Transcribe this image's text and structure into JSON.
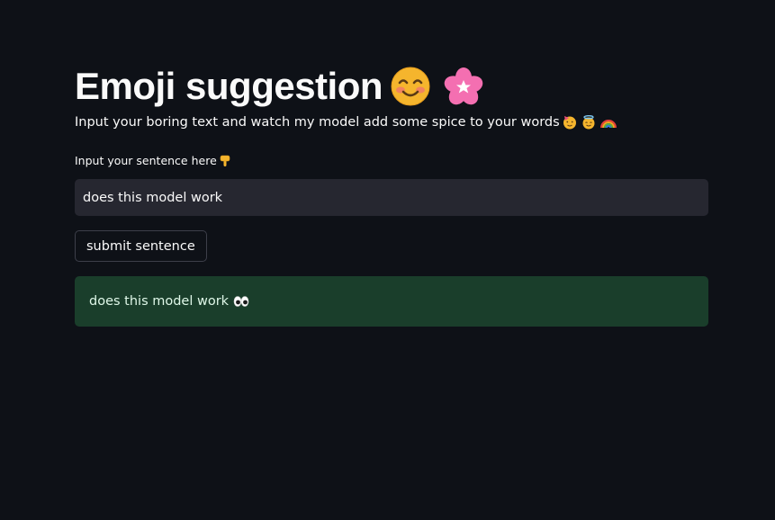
{
  "header": {
    "title": "Emoji suggestion",
    "title_emojis": [
      "smiling-face-icon",
      "cherry-blossom-icon"
    ]
  },
  "intro": {
    "description": "Input your boring text and watch my model add some spice to your words",
    "description_emojis": [
      "partying-face-icon",
      "halo-face-icon",
      "rainbow-icon"
    ]
  },
  "form": {
    "label": "Input your sentence here",
    "label_emoji": "pointing-down-icon",
    "input_value": "does this model work",
    "submit_label": "submit sentence"
  },
  "result": {
    "text": "does this model work",
    "emoji": "eyes-icon"
  },
  "colors": {
    "background": "#0e1117",
    "input_bg": "#262730",
    "success_bg": "#1a3e2b",
    "text": "#fafafa"
  }
}
